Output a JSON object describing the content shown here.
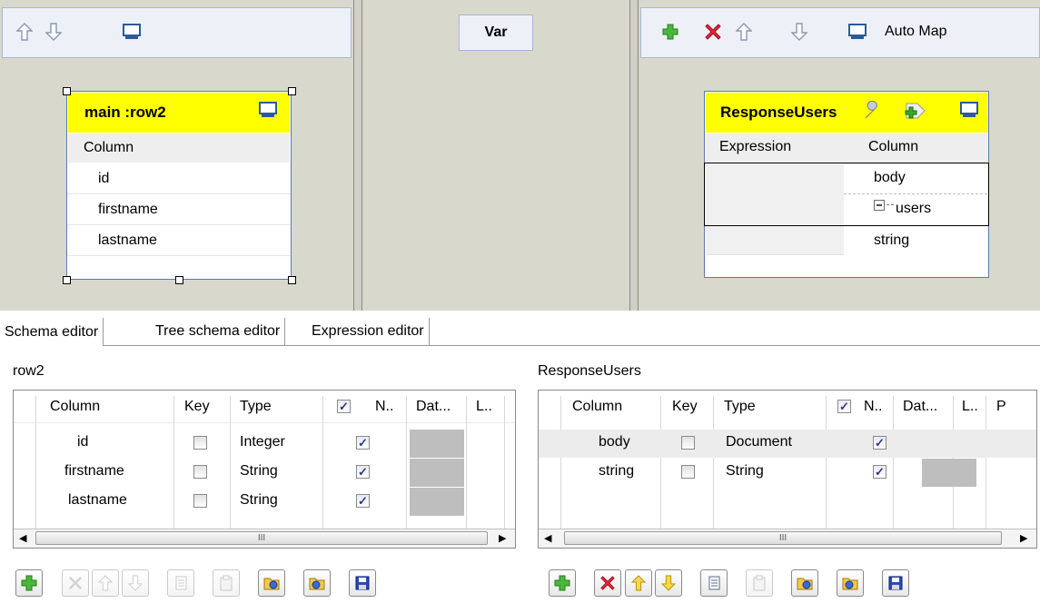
{
  "left_panel": {
    "table": {
      "title": "main :row2",
      "column_header": "Column",
      "rows": [
        "id",
        "firstname",
        "lastname"
      ]
    }
  },
  "var_panel": {
    "label": "Var"
  },
  "right_panel": {
    "toolbar": {
      "auto_map_label": "Auto Map"
    },
    "table": {
      "title": "ResponseUsers",
      "headers": {
        "expression": "Expression",
        "column": "Column"
      },
      "rows": [
        "body",
        "users",
        "string"
      ]
    }
  },
  "tabs": [
    "Schema editor",
    "Tree schema editor",
    "Expression editor"
  ],
  "schema_left": {
    "label": "row2",
    "headers": [
      "Column",
      "Key",
      "Type",
      "N..",
      "Dat...",
      "L.."
    ],
    "rows": [
      {
        "column": "id",
        "type": "Integer",
        "key": false,
        "nullable": true
      },
      {
        "column": "firstname",
        "type": "String",
        "key": false,
        "nullable": true
      },
      {
        "column": "lastname",
        "type": "String",
        "key": false,
        "nullable": true
      }
    ],
    "scroll_glyph": "III"
  },
  "schema_right": {
    "label": "ResponseUsers",
    "headers": [
      "Column",
      "Key",
      "Type",
      "N..",
      "Dat...",
      "L..",
      "P"
    ],
    "rows": [
      {
        "column": "body",
        "type": "Document",
        "key": false,
        "nullable": true
      },
      {
        "column": "string",
        "type": "String",
        "key": false,
        "nullable": true
      }
    ],
    "scroll_glyph": "III"
  },
  "colors": {
    "yellow_header": "#ffff00",
    "panel_bg": "#d8d8cc",
    "add_green": "#3aa82a",
    "delete_red": "#d02030",
    "save_blue": "#2040b0"
  }
}
